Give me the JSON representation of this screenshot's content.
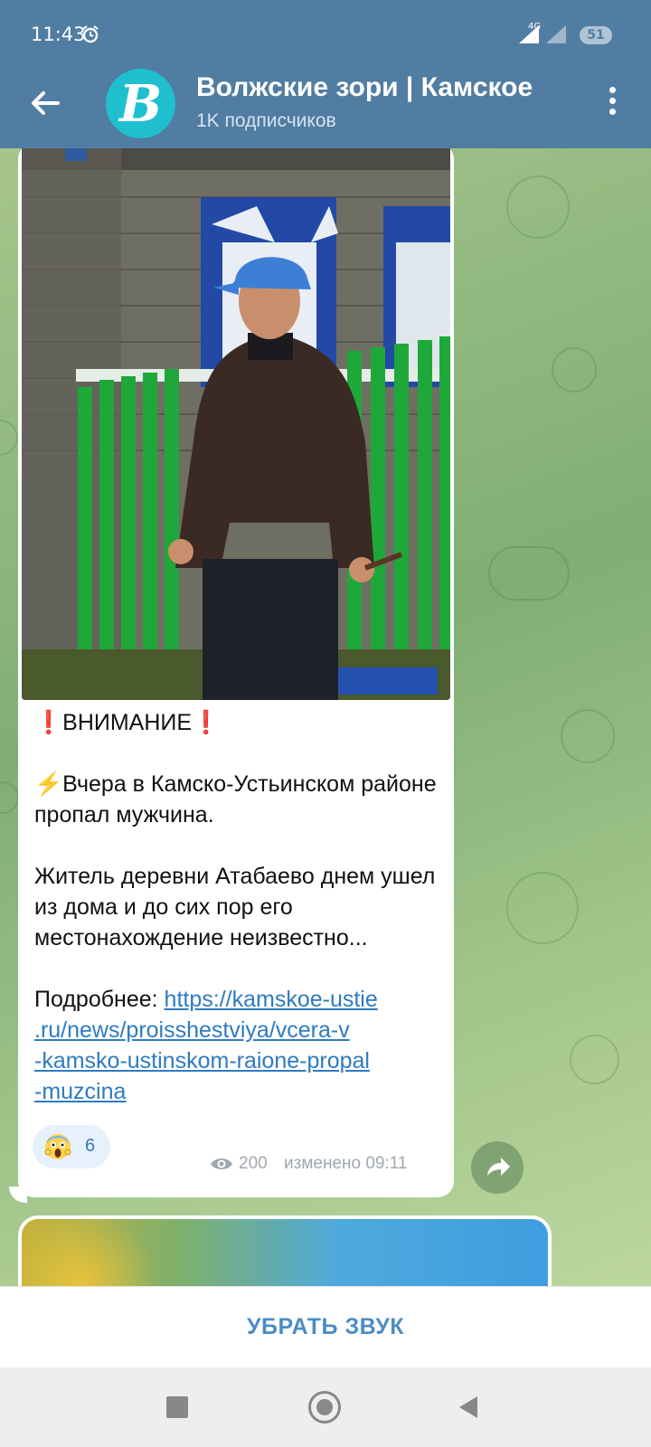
{
  "status_bar": {
    "time": "11:43",
    "network": "4G",
    "battery": "51",
    "icons": [
      "alarm-icon",
      "signal-icon",
      "signal-icon",
      "battery-icon"
    ]
  },
  "header": {
    "back_icon": "arrow-left-icon",
    "avatar_letter": "B",
    "avatar_color": "#1fbfd0",
    "title": "Волжские зори | Камское",
    "subtitle": "1K подписчиков",
    "menu_icon": "more-vertical-icon"
  },
  "post": {
    "image_alt": "man in blue cap standing by green fence",
    "heading": "ВНИМАНИЕ",
    "heading_marks": "❗",
    "lead_icon": "⚡",
    "lead": "Вчера в Камско-Устьинском районе пропал мужчина.",
    "body": "Житель деревни Атабаево днем ушел из дома и до сих пор его местонахождение неизвестно...",
    "more_label": "Подробнее: ",
    "link": "https://kamskoe-ustie.ru/news/proisshestviya/vcera-v-kamsko-ustinskom-raione-propal-muzcina",
    "link_lines": [
      "https://kamskoe-ustie",
      ".ru/news/proisshestviya/vcera-v",
      "-kamsko-ustinskom-raione-propal",
      "-muzcina"
    ],
    "reaction": {
      "emoji": "😱",
      "count": "6"
    },
    "views": "200",
    "edited": "изменено 09:11"
  },
  "share_icon": "share-arrow-icon",
  "mute_button": "УБРАТЬ ЗВУК",
  "colors": {
    "header": "#517da2",
    "link": "#2e7bc1",
    "accent": "#4d8cc4"
  }
}
